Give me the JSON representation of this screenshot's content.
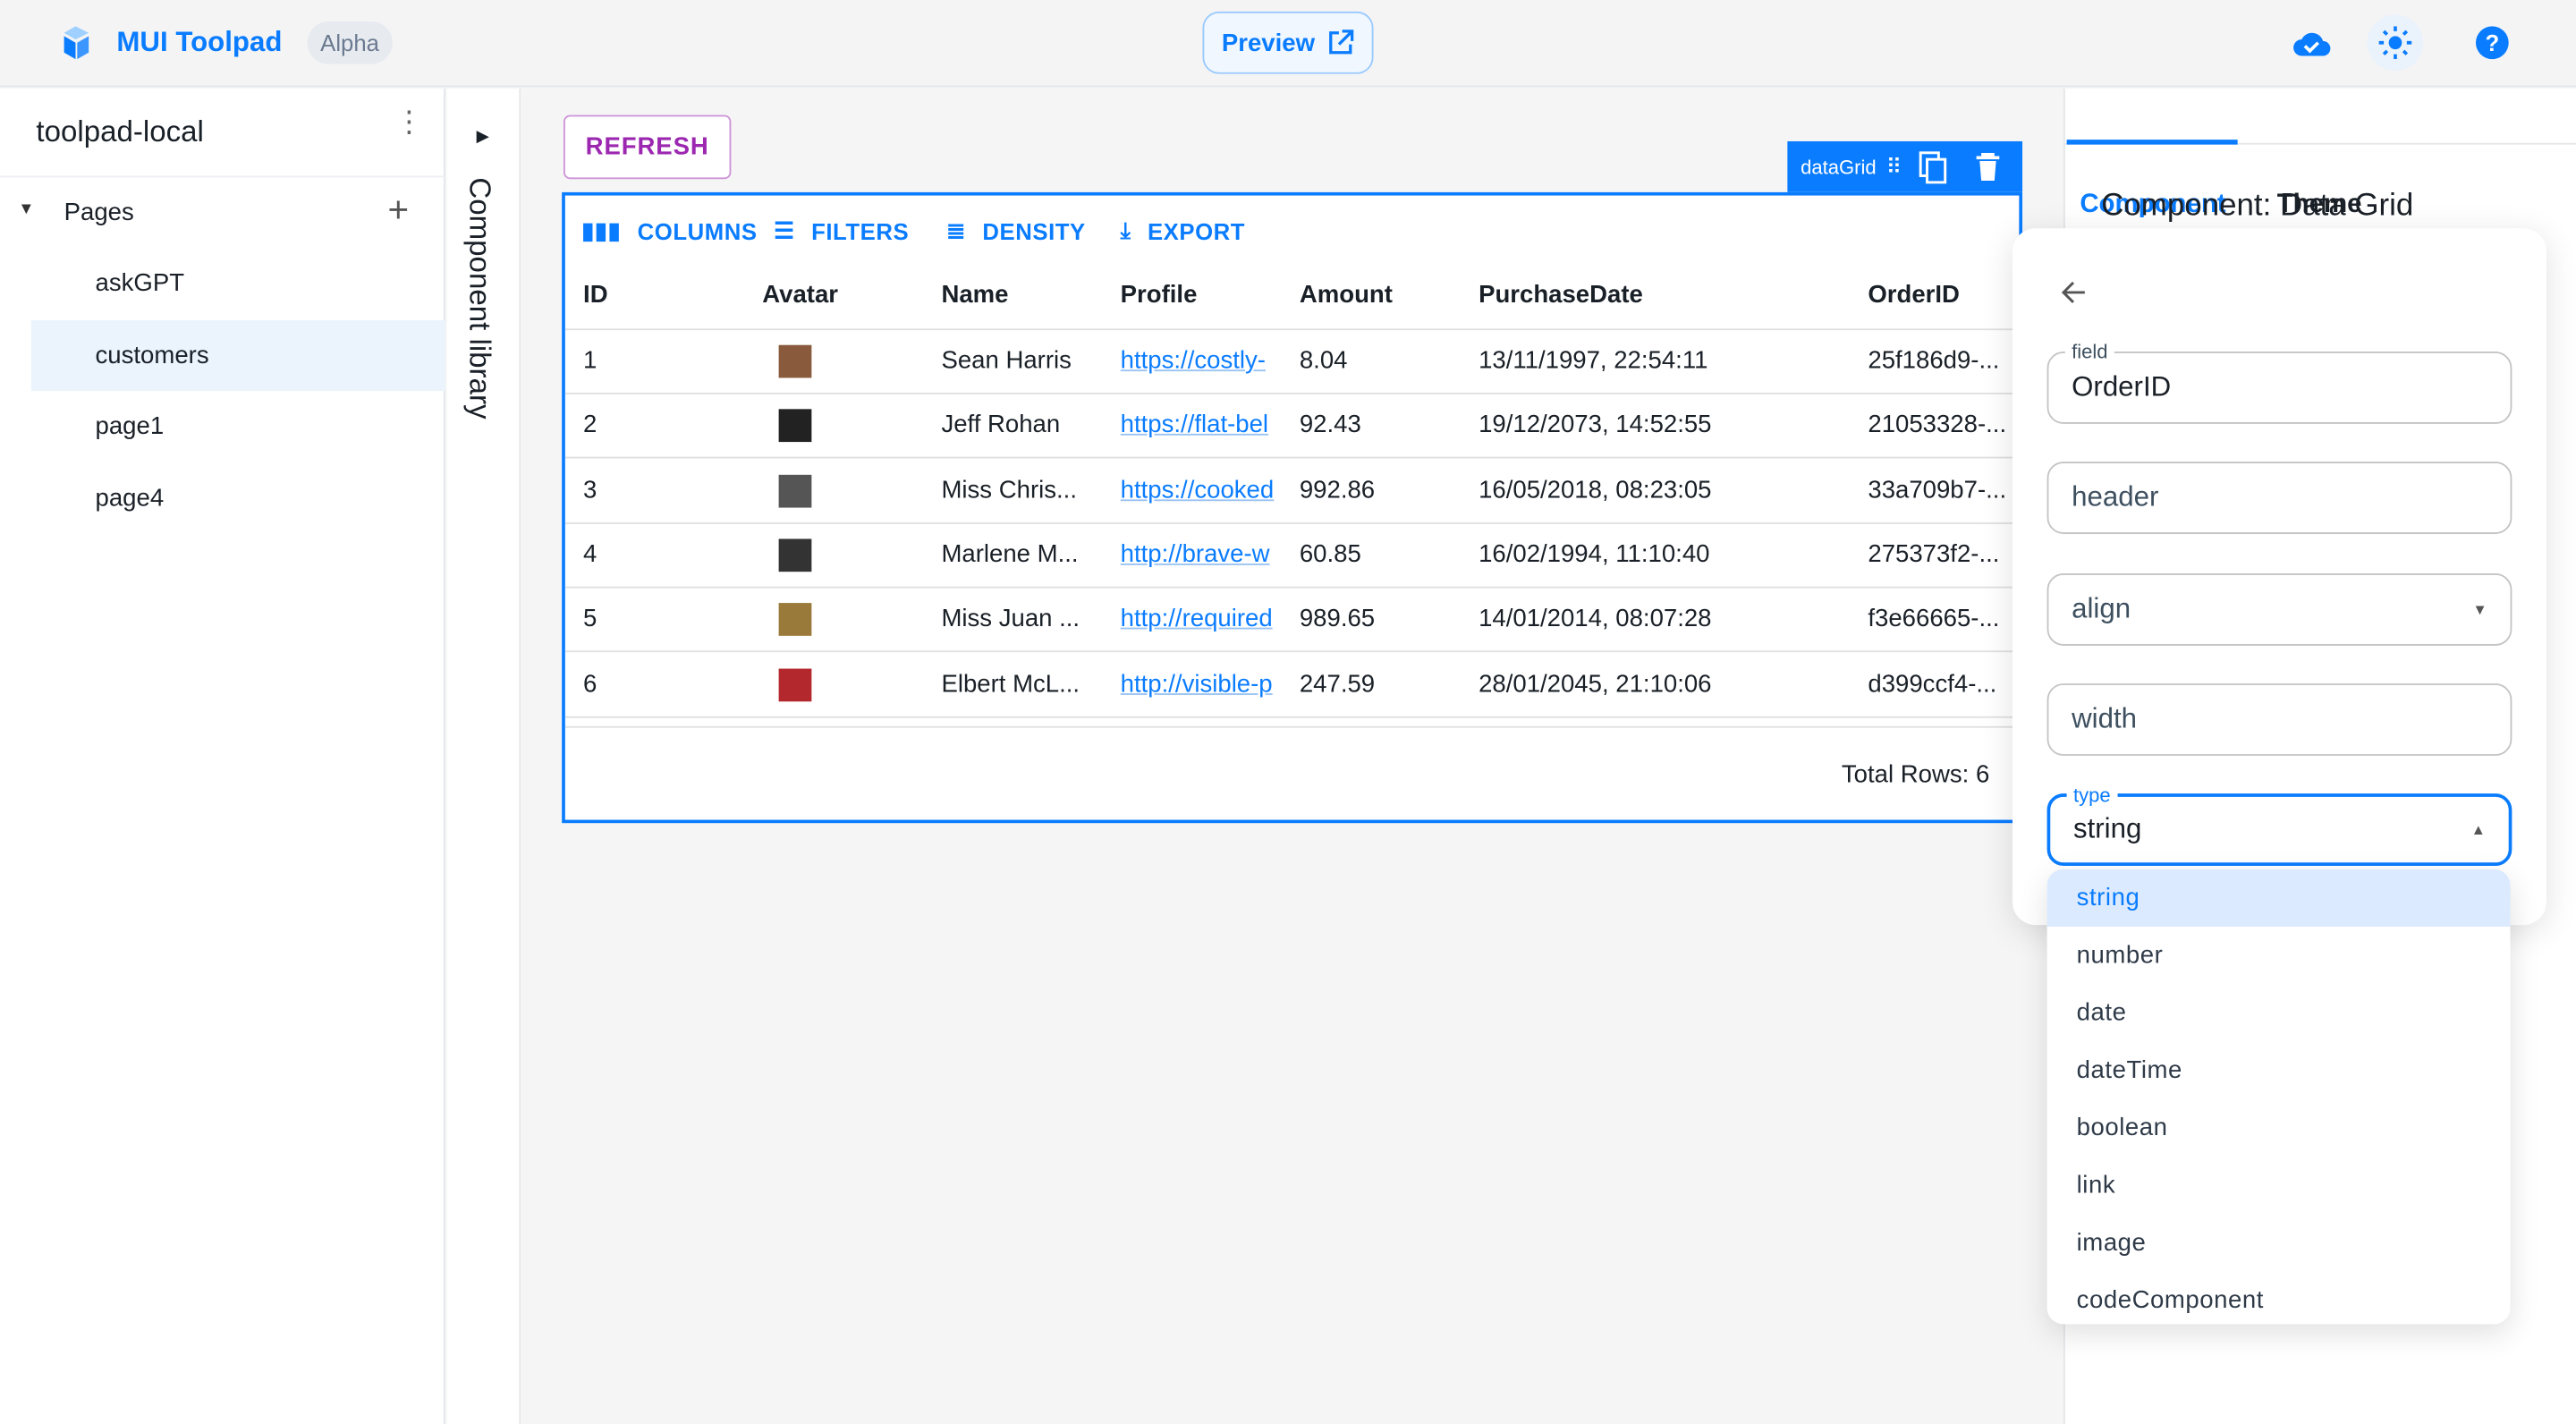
{
  "header": {
    "brand": "MUI Toolpad",
    "badge": "Alpha",
    "preview_label": "Preview",
    "icons": [
      "toolpad-logo-icon",
      "external-link-icon",
      "cloud-check-icon",
      "sun-icon",
      "help-icon"
    ]
  },
  "sidebar": {
    "project": "toolpad-local",
    "pages_label": "Pages",
    "items": [
      {
        "label": "askGPT"
      },
      {
        "label": "customers",
        "selected": true
      },
      {
        "label": "page1"
      },
      {
        "label": "page4"
      }
    ]
  },
  "component_library": {
    "label": "Component library"
  },
  "canvas": {
    "refresh_label": "REFRESH",
    "component_tag": "dataGrid",
    "toolbar": {
      "columns": "COLUMNS",
      "filters": "FILTERS",
      "density": "DENSITY",
      "export": "EXPORT"
    },
    "columns": [
      "ID",
      "Avatar",
      "Name",
      "Profile",
      "Amount",
      "PurchaseDate",
      "OrderID"
    ],
    "rows": [
      {
        "id": "1",
        "name": "Sean Harris",
        "profile": "https://costly-",
        "amount": "8.04",
        "date": "13/11/1997, 22:54:11",
        "order": "25f186d9-...",
        "avatar_color": "#8a5a3c"
      },
      {
        "id": "2",
        "name": "Jeff Rohan",
        "profile": "https://flat-bel",
        "amount": "92.43",
        "date": "19/12/2073, 14:52:55",
        "order": "21053328-...",
        "avatar_color": "#222222"
      },
      {
        "id": "3",
        "name": "Miss Chris...",
        "profile": "https://cooked",
        "amount": "992.86",
        "date": "16/05/2018, 08:23:05",
        "order": "33a709b7-...",
        "avatar_color": "#555555"
      },
      {
        "id": "4",
        "name": "Marlene M...",
        "profile": "http://brave-w",
        "amount": "60.85",
        "date": "16/02/1994, 11:10:40",
        "order": "275373f2-...",
        "avatar_color": "#333333"
      },
      {
        "id": "5",
        "name": "Miss Juan ...",
        "profile": "http://required",
        "amount": "989.65",
        "date": "14/01/2014, 08:07:28",
        "order": "f3e66665-...",
        "avatar_color": "#9a7a3a"
      },
      {
        "id": "6",
        "name": "Elbert McL...",
        "profile": "http://visible-p",
        "amount": "247.59",
        "date": "28/01/2045, 21:10:06",
        "order": "d399ccf4-...",
        "avatar_color": "#b3282d"
      }
    ],
    "footer": "Total Rows: 6"
  },
  "right_panel": {
    "tabs": [
      {
        "label": "Component",
        "active": true
      },
      {
        "label": "Theme"
      }
    ],
    "title": "Component: Data Grid",
    "column_editor": {
      "field_label": "field",
      "field_value": "OrderID",
      "header_placeholder": "header",
      "align_placeholder": "align",
      "width_placeholder": "width",
      "type_label": "type",
      "type_value": "string",
      "type_options": [
        "string",
        "number",
        "date",
        "dateTime",
        "boolean",
        "link",
        "image",
        "codeComponent"
      ]
    }
  },
  "colors": {
    "accent": "#0a7cff",
    "refresh": "#9c27b0",
    "selected_bg": "#dbeafe"
  }
}
